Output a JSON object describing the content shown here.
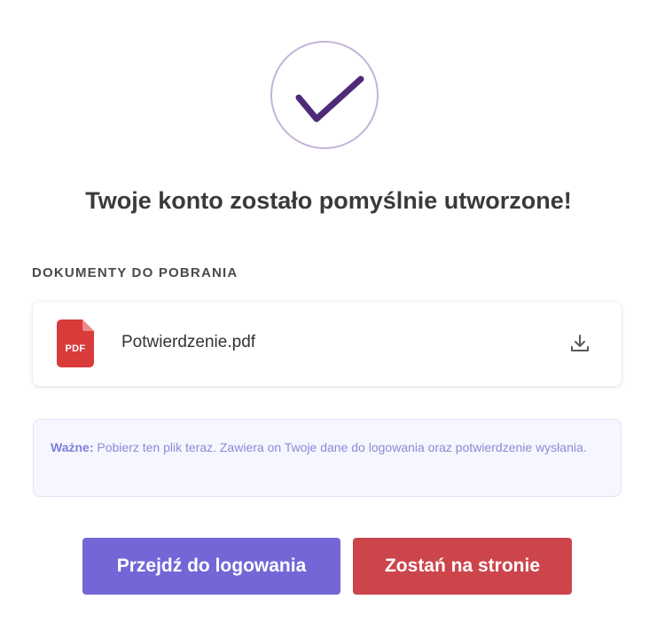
{
  "title": "Twoje konto zostało pomyślnie utworzone!",
  "documents": {
    "section_label": "DOKUMENTY DO POBRANIA",
    "file": {
      "name": "Potwierdzenie.pdf",
      "type_tag": "PDF",
      "icon": "pdf-file-icon",
      "download_icon": "download-icon"
    }
  },
  "notice": {
    "strong": "Ważne:",
    "text": " Pobierz ten plik teraz. Zawiera on Twoje dane do logowania oraz potwierdzenie wysłania."
  },
  "actions": {
    "login_label": "Przejdź do logowania",
    "stay_label": "Zostań na stronie"
  },
  "colors": {
    "check": "#4e2a78",
    "circle_border": "#c4b4d6",
    "pdf_red": "#d93b3b",
    "primary": "#7367d8",
    "danger": "#cc454b",
    "notice_bg": "#f6f6ff",
    "notice_text": "#8a8ad6"
  }
}
